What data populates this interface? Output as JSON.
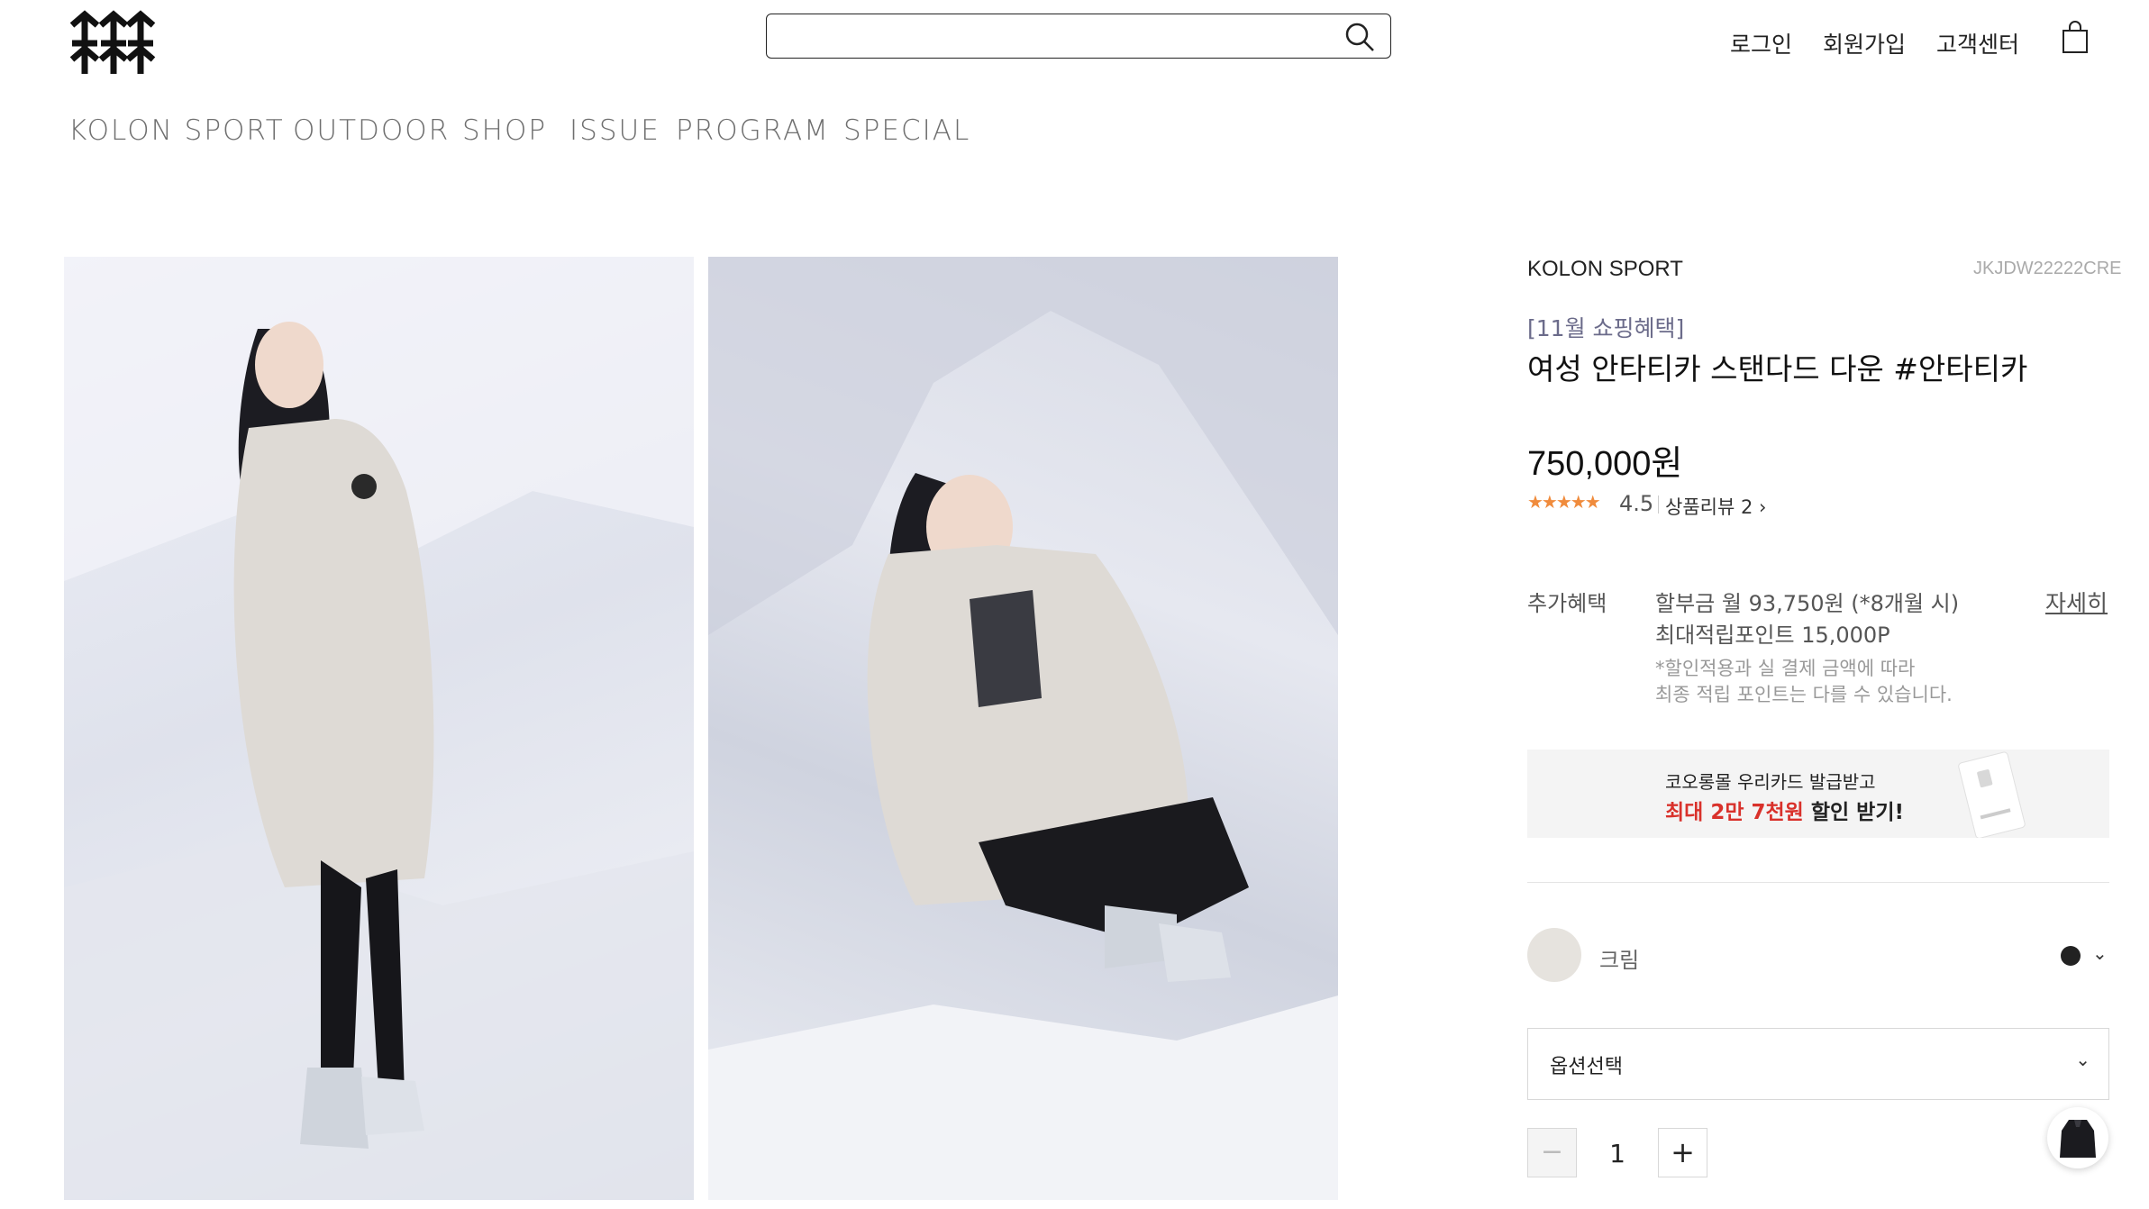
{
  "header": {
    "logo_icon": "kolon-sport-logo-icon",
    "search": {
      "placeholder": "",
      "icon": "search-icon"
    },
    "util": {
      "login": "로그인",
      "signup": "회원가입",
      "customer_center": "고객센터",
      "cart_icon": "shopping-bag-icon"
    }
  },
  "gnb": {
    "items": [
      "KOLON SPORT",
      "OUTDOOR",
      "SHOP",
      "ISSUE",
      "PROGRAM",
      "SPECIAL"
    ]
  },
  "product": {
    "brand": "KOLON SPORT",
    "code": "JKJDW22222CRE",
    "promo": "[11월 쇼핑혜택]",
    "title": "여성 안타티카 스탠다드 다운 #안타티카",
    "price": "750,000원",
    "stars": "★★★★★",
    "rating": "4.5",
    "rating_value": 4.5,
    "review_label": "상품리뷰 2",
    "review_chevron": "›",
    "benefits": {
      "label": "추가혜택",
      "installment": "할부금 월 93,750원 (*8개월 시)",
      "points": "최대적립포인트 15,000P",
      "note1": "*할인적용과 실 결제 금액에 따라",
      "note2": "최종 적립 포인트는 다를 수 있습니다.",
      "detail_link": "자세히"
    },
    "banner": {
      "line1": "코오롱몰 우리카드 발급받고",
      "line2_red": "최대 2만 7천원",
      "line2_rest": " 할인 받기!"
    },
    "color": {
      "name": "크림",
      "chevron": "⌄"
    },
    "option": {
      "label": "옵션선택",
      "chevron": "⌄"
    },
    "quantity": {
      "minus": "−",
      "value": "1",
      "plus": "+"
    }
  },
  "colors": {
    "accent_red": "#d9312b",
    "star": "#f08b3c",
    "swatch_cream": "#e6e3de"
  }
}
